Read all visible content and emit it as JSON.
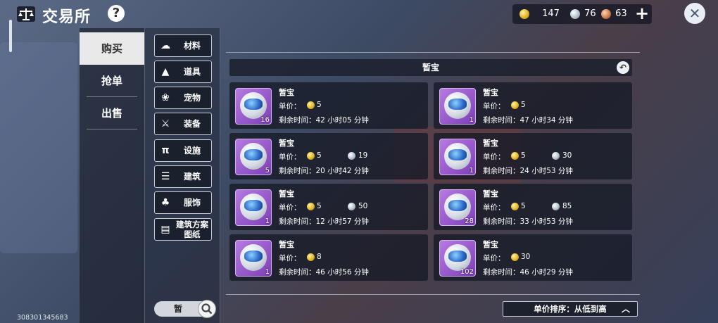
{
  "header": {
    "title": "交易所",
    "help_symbol": "?"
  },
  "currency": {
    "gold": "147",
    "silver": "76",
    "bronze": "63",
    "add_symbol": "+",
    "close_symbol": "✕"
  },
  "left_tabs": [
    {
      "label": "购买"
    },
    {
      "label": "抢单"
    },
    {
      "label": "出售"
    }
  ],
  "categories": [
    {
      "label": "材料",
      "icon": "cloud-icon",
      "glyph": "☁"
    },
    {
      "label": "道具",
      "icon": "flask-icon",
      "glyph": "▲"
    },
    {
      "label": "宠物",
      "icon": "paw-icon",
      "glyph": "❀"
    },
    {
      "label": "装备",
      "icon": "sword-icon",
      "glyph": "⚔"
    },
    {
      "label": "设施",
      "icon": "bench-icon",
      "glyph": "π"
    },
    {
      "label": "建筑",
      "icon": "building-icon",
      "glyph": "☰"
    },
    {
      "label": "服饰",
      "icon": "shirt-icon",
      "glyph": "♣"
    },
    {
      "label": "建筑方案图纸",
      "label_line1": "建筑方案",
      "label_line2": "图纸",
      "icon": "blueprint-icon",
      "glyph": "▤"
    }
  ],
  "search": {
    "value": "暂"
  },
  "main": {
    "section_title": "暂宝",
    "sort_label": "单价排序：从低到高",
    "back_symbol": "↶",
    "caret": "︿"
  },
  "listings": [
    {
      "name": "暂宝",
      "price_label": "单价：",
      "gold": "5",
      "silver": "",
      "qty": "16",
      "time": "剩余时间：42 小时05 分钟"
    },
    {
      "name": "暂宝",
      "price_label": "单价：",
      "gold": "5",
      "silver": "",
      "qty": "1",
      "time": "剩余时间：47 小时34 分钟"
    },
    {
      "name": "暂宝",
      "price_label": "单价：",
      "gold": "5",
      "silver": "19",
      "qty": "5",
      "time": "剩余时间：20 小时42 分钟"
    },
    {
      "name": "暂宝",
      "price_label": "单价：",
      "gold": "5",
      "silver": "30",
      "qty": "1",
      "time": "剩余时间：24 小时53 分钟"
    },
    {
      "name": "暂宝",
      "price_label": "单价：",
      "gold": "5",
      "silver": "50",
      "qty": "1",
      "time": "剩余时间：12 小时57 分钟"
    },
    {
      "name": "暂宝",
      "price_label": "单价：",
      "gold": "5",
      "silver": "85",
      "qty": "28",
      "time": "剩余时间：33 小时53 分钟"
    },
    {
      "name": "暂宝",
      "price_label": "单价：",
      "gold": "8",
      "silver": "",
      "qty": "1",
      "time": "剩余时间：46 小时56 分钟"
    },
    {
      "name": "暂宝",
      "price_label": "单价：",
      "gold": "30",
      "silver": "",
      "qty": "102",
      "time": "剩余时间：46 小时29 分钟"
    }
  ],
  "player_id": "308301345683"
}
